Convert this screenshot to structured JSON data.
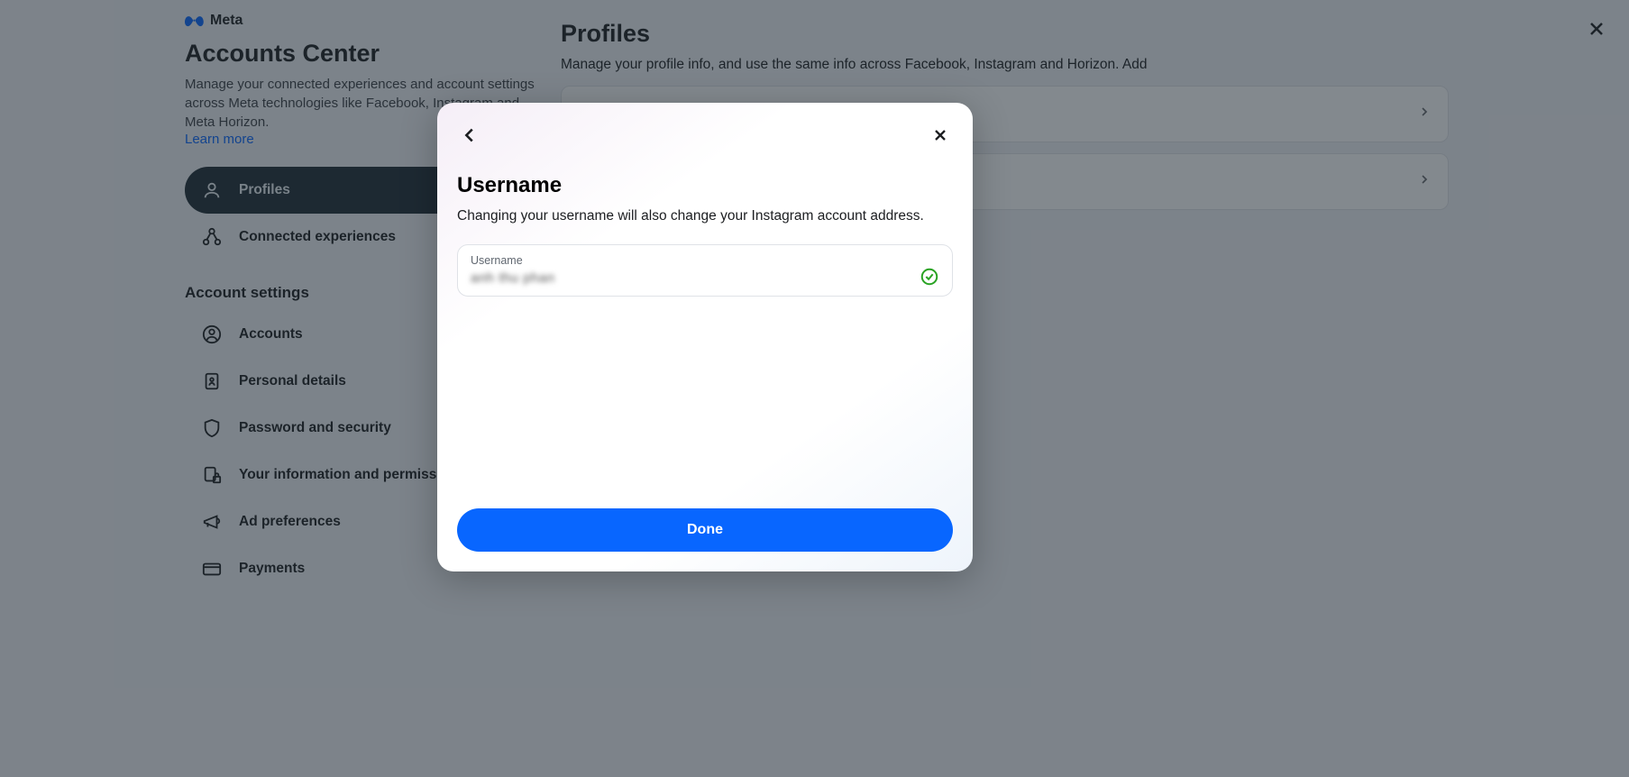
{
  "brand": "Meta",
  "sidebar": {
    "title": "Accounts Center",
    "description": "Manage your connected experiences and account settings across Meta technologies like Facebook, Instagram and Meta Horizon.",
    "learn_more": "Learn more",
    "nav": {
      "profiles": "Profiles",
      "connected": "Connected experiences"
    },
    "section_label": "Account settings",
    "settings": {
      "accounts": "Accounts",
      "personal": "Personal details",
      "password": "Password and security",
      "info": "Your information and permissions",
      "ads": "Ad preferences",
      "payments": "Payments"
    }
  },
  "main": {
    "title": "Profiles",
    "description": "Manage your profile info, and use the same info across Facebook, Instagram and Horizon. Add"
  },
  "modal": {
    "title": "Username",
    "description": "Changing your username will also change your Instagram account address.",
    "input_label": "Username",
    "input_value": "anh thu phan",
    "done": "Done"
  }
}
